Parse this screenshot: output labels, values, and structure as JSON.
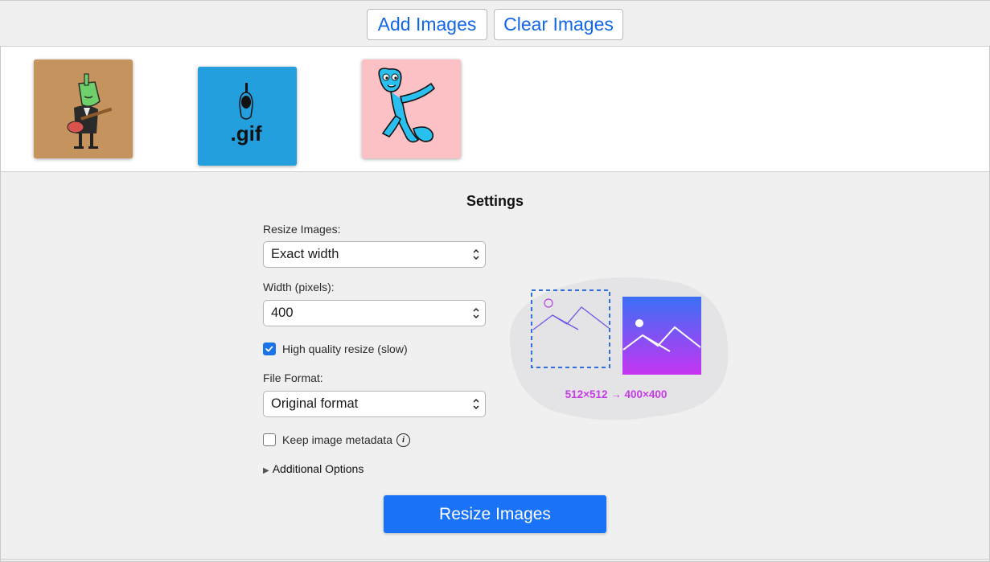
{
  "toolbar": {
    "add_label": "Add Images",
    "clear_label": "Clear Images"
  },
  "thumbnails": [
    {
      "icon": "guitar-character-icon",
      "bg": "#c4935e"
    },
    {
      "icon": "gif-file-icon",
      "bg": "#229fdc",
      "text": ".gif"
    },
    {
      "icon": "dancing-character-icon",
      "bg": "#fcc1c4"
    }
  ],
  "settings": {
    "title": "Settings",
    "resize_label": "Resize Images:",
    "resize_value": "Exact width",
    "width_label": "Width (pixels):",
    "width_value": "400",
    "hq_label": "High quality resize (slow)",
    "hq_checked": true,
    "format_label": "File Format:",
    "format_value": "Original format",
    "metadata_label": "Keep image metadata",
    "metadata_checked": false,
    "info_glyph": "i",
    "additional_label": "Additional Options",
    "resize_button": "Resize Images"
  },
  "illustration": {
    "caption": "512×512 → 400×400",
    "accent": "#c43be8",
    "gradient_from": "#3a6ff5",
    "gradient_to": "#c635f2"
  },
  "colors": {
    "primary": "#1a73f7",
    "link": "#1167e8"
  }
}
